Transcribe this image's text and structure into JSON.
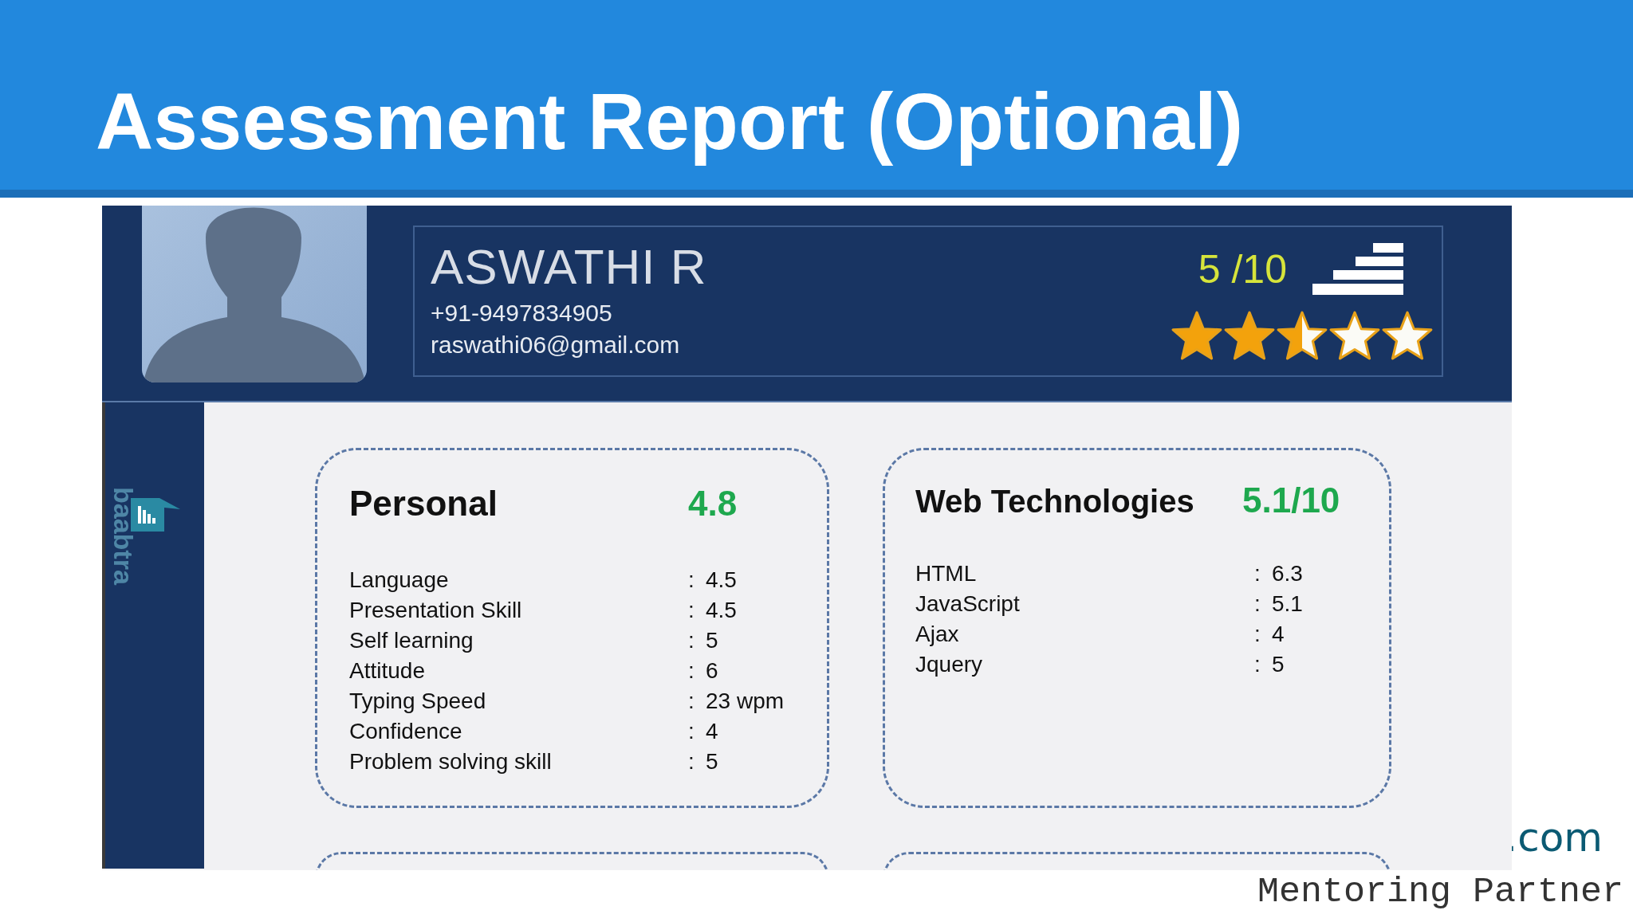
{
  "slide": {
    "title": "Assessment Report (Optional)",
    "footer_link": ".com",
    "footer_tagline": "Mentoring Partner"
  },
  "report": {
    "logo": "baabtra",
    "name": "ASWATHI R",
    "phone": "+91-9497834905",
    "email": "raswathi06@gmail.com",
    "score": "5 /10",
    "stars": 2.5,
    "sections": [
      {
        "title": "Personal",
        "score": "4.8",
        "rows": [
          {
            "label": "Language",
            "separator": ":",
            "value": "4.5"
          },
          {
            "label": "Presentation Skill",
            "separator": ":",
            "value": "4.5"
          },
          {
            "label": "Self learning",
            "separator": ":",
            "value": "5"
          },
          {
            "label": "Attitude",
            "separator": ":",
            "value": "6"
          },
          {
            "label": "Typing Speed",
            "separator": ":",
            "value": "23 wpm"
          },
          {
            "label": "Confidence",
            "separator": ":",
            "value": "4"
          },
          {
            "label": "Problem solving skill",
            "separator": ":",
            "value": "5"
          }
        ]
      },
      {
        "title": "Web Technologies",
        "score": "5.1/10",
        "rows": [
          {
            "label": "HTML",
            "separator": ":",
            "value": "6.3"
          },
          {
            "label": "JavaScript",
            "separator": ":",
            "value": "5.1"
          },
          {
            "label": "Ajax",
            "separator": ":",
            "value": "4"
          },
          {
            "label": "Jquery",
            "separator": ":",
            "value": "5"
          }
        ]
      }
    ]
  }
}
